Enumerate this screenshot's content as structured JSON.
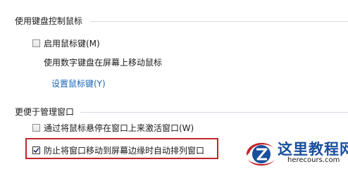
{
  "keyboard_section": {
    "heading": "使用键盘控制鼠标",
    "enable_mouse_keys": {
      "label": "启用鼠标键(M)",
      "checked": false
    },
    "description": "使用数字键盘在屏幕上移动鼠标",
    "setup_link": "设置鼠标键(Y)"
  },
  "window_section": {
    "heading": "更便于管理窗口",
    "activate_on_hover": {
      "label": "通过将鼠标悬停在窗口上来激活窗口(W)",
      "checked": false
    },
    "prevent_auto_arrange": {
      "label": "防止将窗口移动到屏幕边缘时自动排列窗口",
      "checked": true
    }
  },
  "watermark": {
    "title": "这里教程网",
    "url": "herecours.com",
    "icon": "z-logo-icon"
  },
  "colors": {
    "link": "#1a66b8",
    "highlight_border": "#c0262b",
    "divider": "#d4dbe6",
    "watermark_blue": "#1a4f9c"
  }
}
